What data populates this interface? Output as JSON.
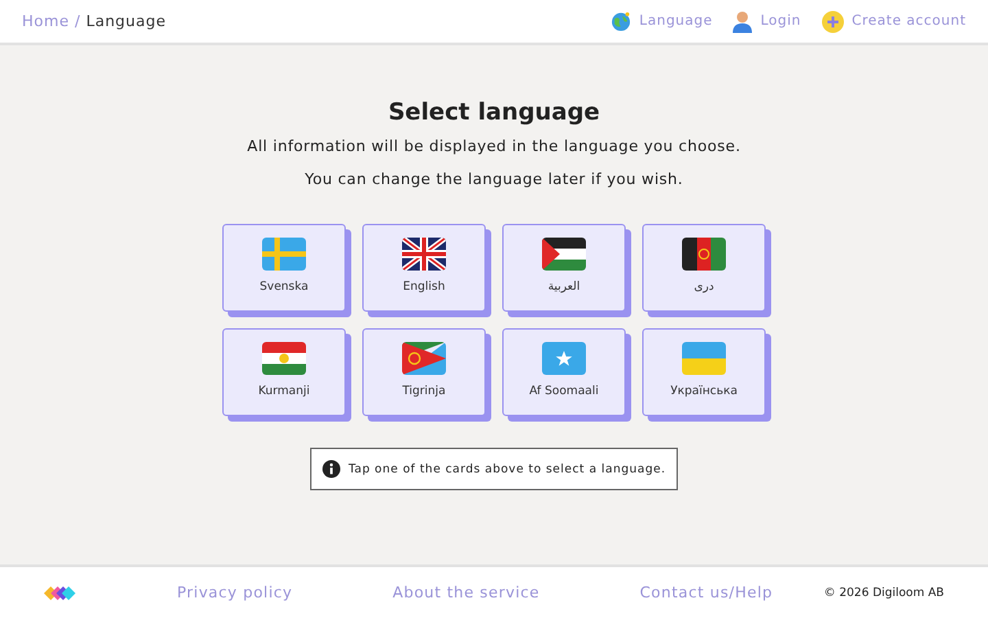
{
  "breadcrumb": {
    "home": "Home",
    "separator": "/",
    "current": "Language"
  },
  "nav": [
    {
      "kind": "language",
      "label": "Language"
    },
    {
      "kind": "login",
      "label": "Login"
    },
    {
      "kind": "create",
      "label": "Create account"
    }
  ],
  "title": "Select language",
  "intro": [
    "All information will be displayed in the language you choose.",
    "You can change the language later if you wish."
  ],
  "languages": [
    {
      "label": "Svenska"
    },
    {
      "label": "English"
    },
    {
      "label": "العربية"
    },
    {
      "label": "دری"
    },
    {
      "label": "Kurmanji"
    },
    {
      "label": "Tigrinja"
    },
    {
      "label": "Af Soomaali"
    },
    {
      "label": "Українська"
    }
  ],
  "hint": "Tap one of the cards above to select a language.",
  "footer": {
    "links": [
      "Privacy policy",
      "About the service",
      "Contact us/Help"
    ],
    "copyright": "© 2026 Digiloom AB"
  }
}
